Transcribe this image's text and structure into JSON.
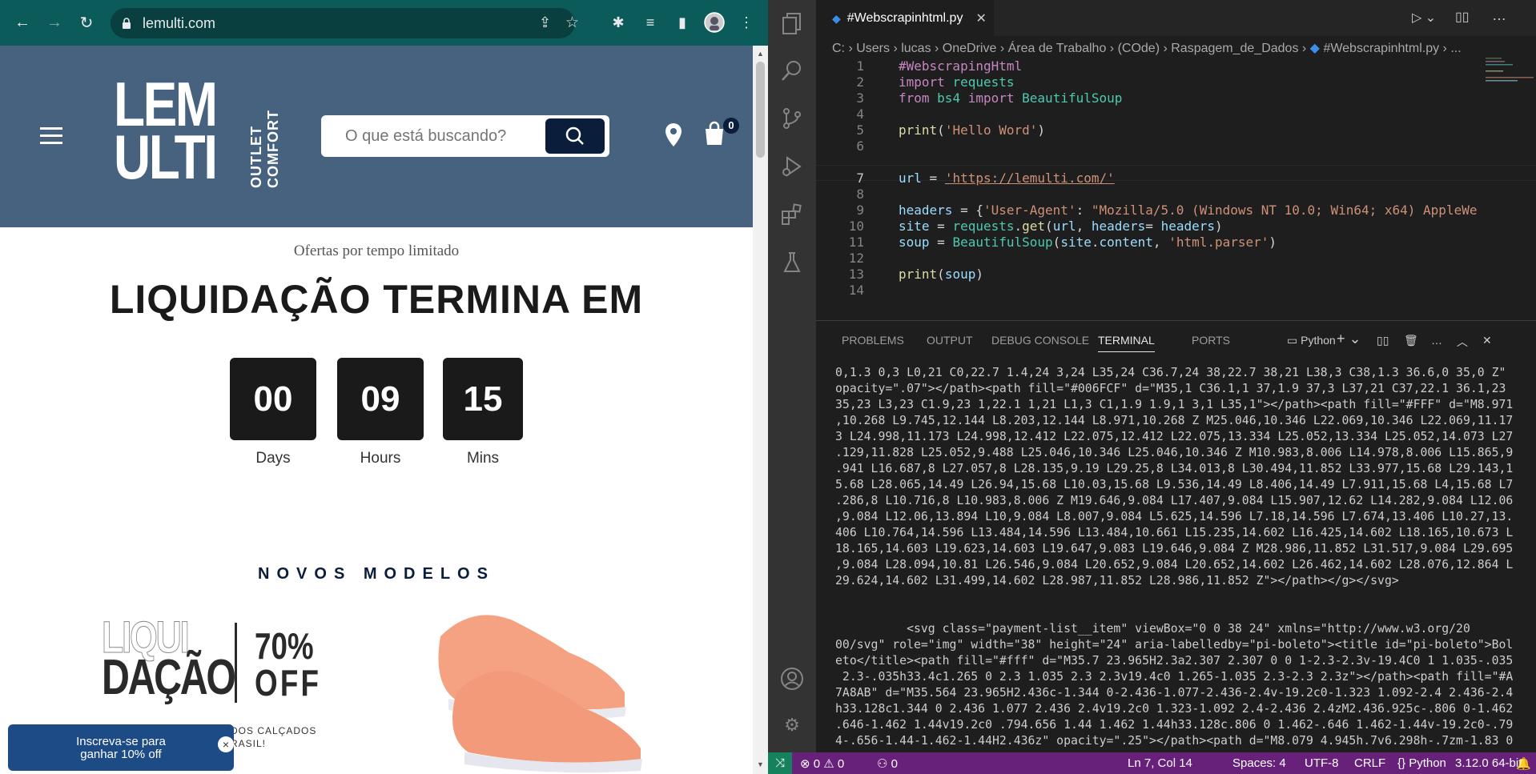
{
  "browser": {
    "url": "lemulti.com",
    "logo": {
      "line1": "LEM",
      "line2": "ULTI",
      "tagline": "OUTLET COMFORT"
    },
    "search_placeholder": "O que está buscando?",
    "cart_count": "0",
    "offers_text": "Ofertas por tempo limitado",
    "sale_title": "LIQUIDAÇÃO TERMINA EM",
    "countdown": [
      {
        "value": "00",
        "label": "Days"
      },
      {
        "value": "09",
        "label": "Hours"
      },
      {
        "value": "15",
        "label": "Mins"
      }
    ],
    "new_models": "NOVOS MODELOS",
    "promo": {
      "word1": "LIQUI",
      "word2": "DAÇÃO",
      "pct": "70%",
      "off": "OFF",
      "sub1": "DOS CALÇADOS",
      "sub2": "RASIL!"
    },
    "newsletter": {
      "line1": "Inscreva-se para",
      "line2": "ganhar 10% off",
      "close": "×"
    }
  },
  "vscode": {
    "tab_title": "#Webscrapinhtml.py",
    "breadcrumb": [
      "C:",
      "Users",
      "lucas",
      "OneDrive",
      "Área de Trabalho",
      "(COde)",
      "Raspagem_de_Dados",
      "#Webscrapinhtml.py",
      "..."
    ],
    "code": {
      "l1": "#WebscrapingHtml",
      "l2a": "import",
      "l2b": "requests",
      "l3a": "from",
      "l3b": "bs4",
      "l3c": "import",
      "l3d": "BeautifulSoup",
      "l5a": "print",
      "l5b": "'Hello Word'",
      "l7a": "url",
      "l7b": "'https://lemulti.com/'",
      "l9a": "headers",
      "l9b": "'User-Agent'",
      "l9c": "\"Mozilla/5.0 (Windows NT 10.0; Win64; x64) AppleWe",
      "l10a": "site",
      "l10b": "requests",
      "l10c": "get",
      "l10d": "url",
      "l10e": "headers",
      "l11a": "soup",
      "l11b": "BeautifulSoup",
      "l11c": "site",
      "l11d": "content",
      "l11e": "'html.parser'",
      "l13a": "print",
      "l13b": "soup"
    },
    "panel_tabs": [
      "PROBLEMS",
      "OUTPUT",
      "DEBUG CONSOLE",
      "TERMINAL",
      "PORTS"
    ],
    "terminal_profile": "Python",
    "terminal_text": "0,1.3 0,3 L0,21 C0,22.7 1.4,24 3,24 L35,24 C36.7,24 38,22.7 38,21 L38,3 C38,1.3 36.6,0 35,0 Z\"\nopacity=\".07\"></path><path fill=\"#006FCF\" d=\"M35,1 C36.1,1 37,1.9 37,3 L37,21 C37,22.1 36.1,23\n35,23 L3,23 C1.9,23 1,22.1 1,21 L1,3 C1,1.9 1.9,1 3,1 L35,1\"></path><path fill=\"#FFF\" d=\"M8.971\n,10.268 L9.745,12.144 L8.203,12.144 L8.971,10.268 Z M25.046,10.346 L22.069,10.346 L22.069,11.17\n3 L24.998,11.173 L24.998,12.412 L22.075,12.412 L22.075,13.334 L25.052,13.334 L25.052,14.073 L27\n.129,11.828 L25.052,9.488 L25.046,10.346 L25.046,10.346 Z M10.983,8.006 L14.978,8.006 L15.865,9\n.941 L16.687,8 L27.057,8 L28.135,9.19 L29.25,8 L34.013,8 L30.494,11.852 L33.977,15.68 L29.143,1\n5.68 L28.065,14.49 L26.94,15.68 L10.03,15.68 L9.536,14.49 L8.406,14.49 L7.911,15.68 L4,15.68 L7\n.286,8 L10.716,8 L10.983,8.006 Z M19.646,9.084 L17.407,9.084 L15.907,12.62 L14.282,9.084 L12.06\n,9.084 L12.06,13.894 L10,9.084 L8.007,9.084 L5.625,14.596 L7.18,14.596 L7.674,13.406 L10.27,13.\n406 L10.764,14.596 L13.484,14.596 L13.484,10.661 L15.235,14.602 L16.425,14.602 L18.165,10.673 L\n18.165,14.603 L19.623,14.603 L19.647,9.083 L19.646,9.084 Z M28.986,11.852 L31.517,9.084 L29.695\n,9.084 L28.094,10.81 L26.546,9.084 L20.652,9.084 L20.652,14.602 L26.462,14.602 L28.076,12.864 L\n29.624,14.602 L31.499,14.602 L28.987,11.852 L28.986,11.852 Z\"></path></g></svg>\n\n\n          <svg class=\"payment-list__item\" viewBox=\"0 0 38 24\" xmlns=\"http://www.w3.org/20\n00/svg\" role=\"img\" width=\"38\" height=\"24\" aria-labelledby=\"pi-boleto\"><title id=\"pi-boleto\">Bol\neto</title><path fill=\"#fff\" d=\"M35.7 23.965H2.3a2.307 2.307 0 0 1-2.3-2.3v-19.4C0 1 1.035-.035\n 2.3-.035h33.4c1.265 0 2.3 1.035 2.3 2.3v19.4c0 1.265-1.035 2.3-2.3 2.3z\"></path><path fill=\"#A\n7A8AB\" d=\"M35.564 23.965H2.436c-1.344 0-2.436-1.077-2.436-2.4v-19.2c0-1.323 1.092-2.4 2.436-2.4\nh33.128c1.344 0 2.436 1.077 2.436 2.4v19.2c0 1.323-1.092 2.4-2.436 2.4zM2.436.925c-.806 0-1.462\n.646-1.462 1.44v19.2c0 .794.656 1.44 1.462 1.44h33.128c.806 0 1.462-.646 1.462-1.44v-19.2c0-.79\n4-.656-1.44-1.462-1.44H2.436z\" opacity=\".25\"></path><path d=\"M8.079 4.945h.7v6.298h-.7zm-1.83 0",
    "status": {
      "errors": "0",
      "warnings": "0",
      "ports": "0",
      "position": "Ln 7, Col 14",
      "spaces": "Spaces: 4",
      "encoding": "UTF-8",
      "eol": "CRLF",
      "language": "Python",
      "interpreter": "3.12.0 64-bit"
    }
  },
  "colors": {
    "header_bg": "#46627f",
    "chrome_bg": "#0b5b5b",
    "status_bg": "#68217a",
    "accent_dark": "#0a1d3a"
  }
}
